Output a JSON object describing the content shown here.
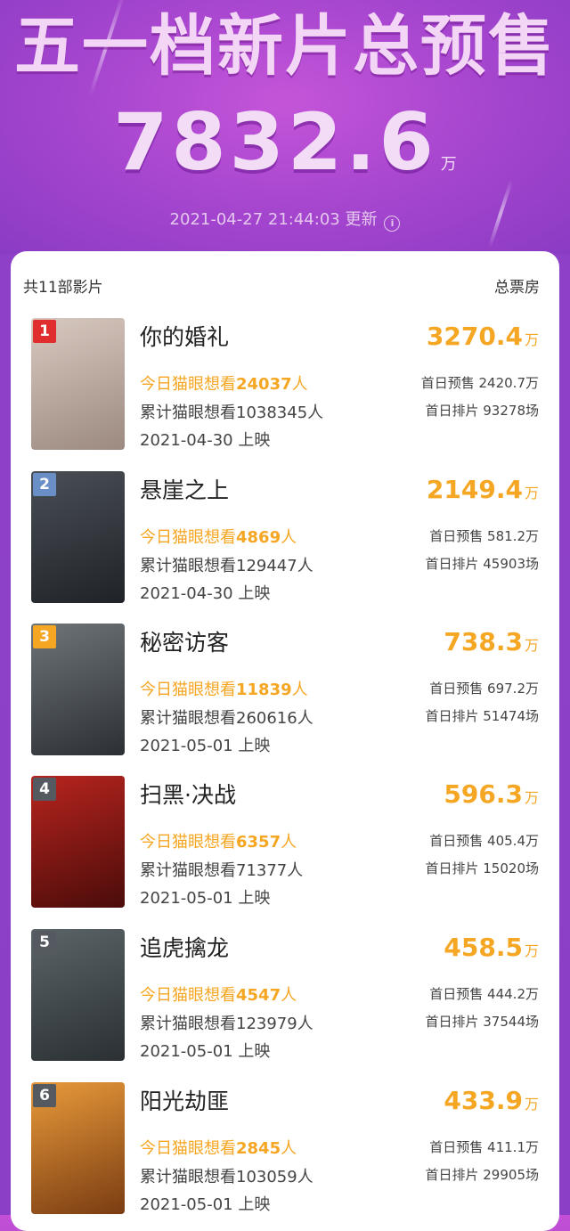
{
  "header": {
    "title": "五一档新片总预售",
    "total_value": "7832.6",
    "total_unit": "万",
    "update_time": "2021-04-27 21:44:03 更新"
  },
  "list": {
    "count_label": "共11部影片",
    "box_label": "总票房"
  },
  "films": [
    {
      "rank": "1",
      "name": "你的婚礼",
      "today_prefix": "今日猫眼想看",
      "today_num": "24037",
      "today_suffix": "人",
      "cumulative": "累计猫眼想看1038345人",
      "release": "2021-04-30 上映",
      "gross": "3270.4",
      "gross_unit": "万",
      "presale": "首日预售 2420.7万",
      "shows": "首日排片 93278场",
      "rank_color": "#e02d2d",
      "poster_colors": [
        "#d8c9c0",
        "#9c8a80"
      ]
    },
    {
      "rank": "2",
      "name": "悬崖之上",
      "today_prefix": "今日猫眼想看",
      "today_num": "4869",
      "today_suffix": "人",
      "cumulative": "累计猫眼想看129447人",
      "release": "2021-04-30 上映",
      "gross": "2149.4",
      "gross_unit": "万",
      "presale": "首日预售 581.2万",
      "shows": "首日排片 45903场",
      "rank_color": "#6a8fc7",
      "poster_colors": [
        "#4a4f56",
        "#1f2328"
      ]
    },
    {
      "rank": "3",
      "name": "秘密访客",
      "today_prefix": "今日猫眼想看",
      "today_num": "11839",
      "today_suffix": "人",
      "cumulative": "累计猫眼想看260616人",
      "release": "2021-05-01 上映",
      "gross": "738.3",
      "gross_unit": "万",
      "presale": "首日预售 697.2万",
      "shows": "首日排片 51474场",
      "rank_color": "#f5a623",
      "poster_colors": [
        "#6e7478",
        "#2c3034"
      ]
    },
    {
      "rank": "4",
      "name": "扫黑·决战",
      "today_prefix": "今日猫眼想看",
      "today_num": "6357",
      "today_suffix": "人",
      "cumulative": "累计猫眼想看71377人",
      "release": "2021-05-01 上映",
      "gross": "596.3",
      "gross_unit": "万",
      "presale": "首日预售 405.4万",
      "shows": "首日排片 15020场",
      "rank_color": "#555a60",
      "poster_colors": [
        "#b8241e",
        "#4a0c0a"
      ]
    },
    {
      "rank": "5",
      "name": "追虎擒龙",
      "today_prefix": "今日猫眼想看",
      "today_num": "4547",
      "today_suffix": "人",
      "cumulative": "累计猫眼想看123979人",
      "release": "2021-05-01 上映",
      "gross": "458.5",
      "gross_unit": "万",
      "presale": "首日预售 444.2万",
      "shows": "首日排片 37544场",
      "rank_color": "#555a60",
      "poster_colors": [
        "#5b6468",
        "#2a3033"
      ]
    },
    {
      "rank": "6",
      "name": "阳光劫匪",
      "today_prefix": "今日猫眼想看",
      "today_num": "2845",
      "today_suffix": "人",
      "cumulative": "累计猫眼想看103059人",
      "release": "2021-05-01 上映",
      "gross": "433.9",
      "gross_unit": "万",
      "presale": "首日预售 411.1万",
      "shows": "首日排片 29905场",
      "rank_color": "#555a60",
      "poster_colors": [
        "#e89a3a",
        "#7a3c12"
      ]
    }
  ]
}
